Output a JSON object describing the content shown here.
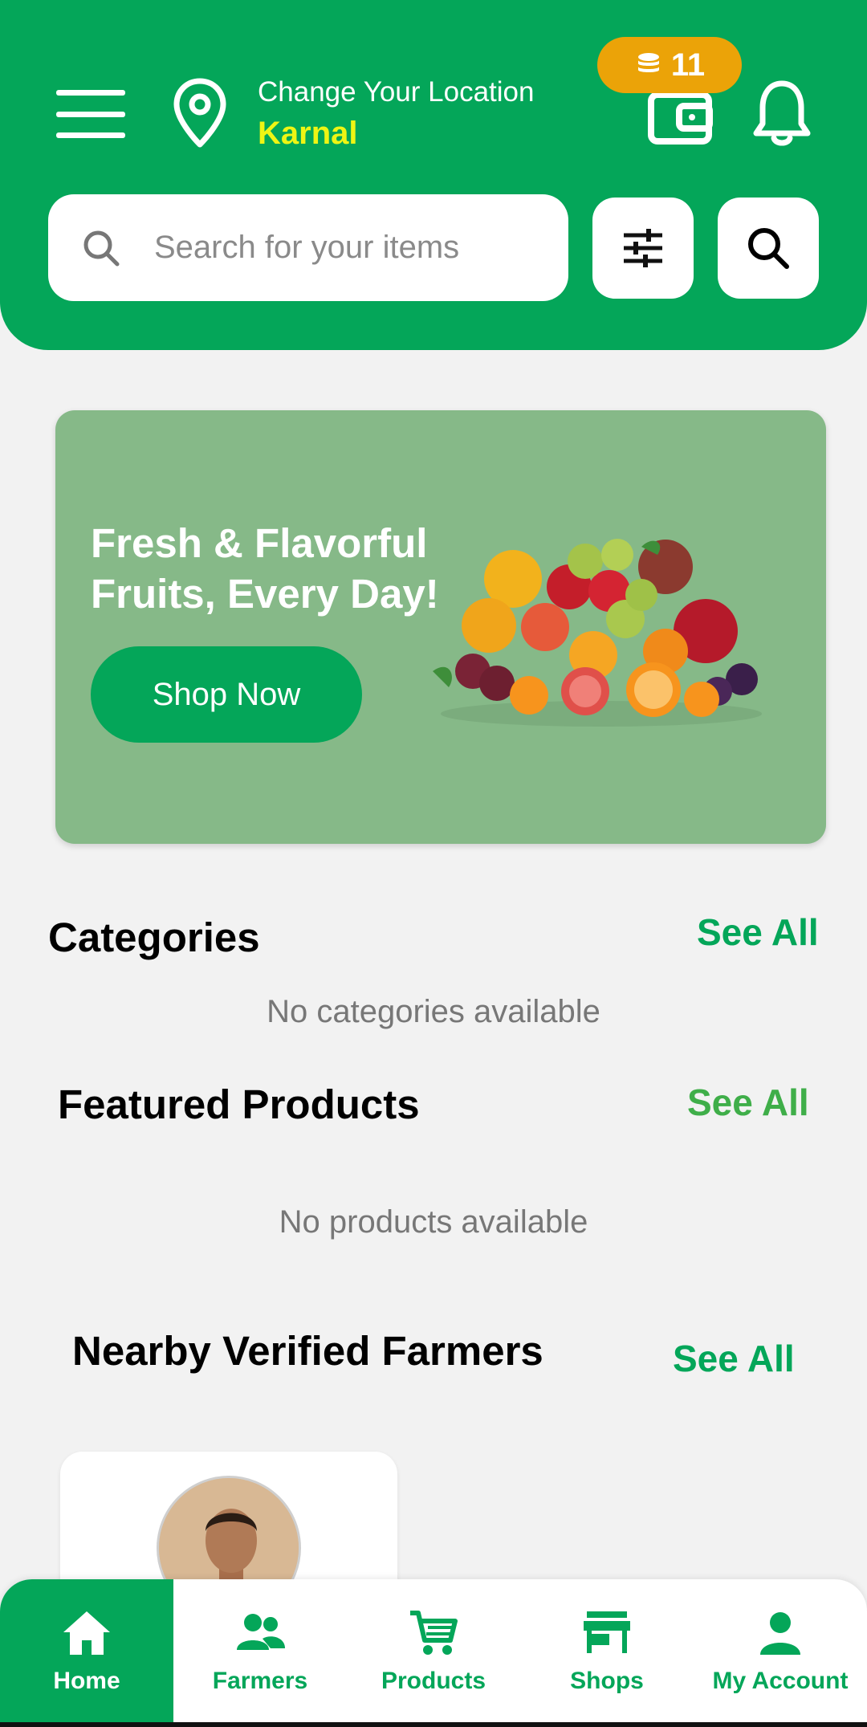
{
  "header": {
    "location_label": "Change Your Location",
    "location_city": "Karnal",
    "coin_count": "11",
    "search_placeholder": "Search for your items"
  },
  "banner": {
    "title": "Fresh & Flavorful Fruits, Every Day!",
    "button": "Shop Now"
  },
  "categories": {
    "title": "Categories",
    "see_all": "See All",
    "empty": "No categories available"
  },
  "featured": {
    "title": "Featured Products",
    "see_all": "See All",
    "empty": "No products available"
  },
  "farmers": {
    "title": "Nearby Verified Farmers",
    "see_all": "See All"
  },
  "nav": {
    "items": [
      {
        "label": "Home",
        "icon": "home-icon"
      },
      {
        "label": "Farmers",
        "icon": "people-icon"
      },
      {
        "label": "Products",
        "icon": "cart-icon"
      },
      {
        "label": "Shops",
        "icon": "store-icon"
      },
      {
        "label": "My Account",
        "icon": "person-icon"
      }
    ],
    "active": "Home"
  },
  "colors": {
    "brand_green": "#04a659",
    "banner_green": "#86b988",
    "coin_orange": "#eba308",
    "city_yellow": "#eef514",
    "see_all_alt": "#3fae49"
  }
}
